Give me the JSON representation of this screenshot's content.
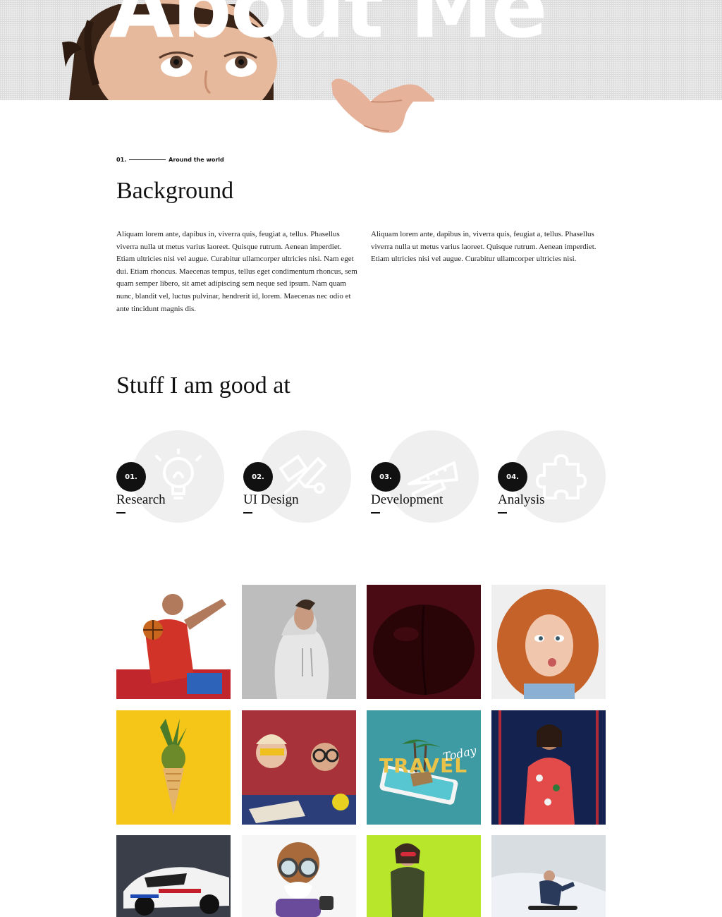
{
  "hero": {
    "title": "About Me"
  },
  "background_section": {
    "index": "01.",
    "tagline": "Around the world",
    "heading": "Background",
    "paragraph_left": "Aliquam lorem ante, dapibus in, viverra quis, feugiat a, tellus. Phasellus viverra nulla ut metus varius laoreet. Quisque rutrum. Aenean imperdiet. Etiam ultricies nisi vel augue. Curabitur ullamcorper ultricies nisi. Nam eget dui. Etiam rhoncus. Maecenas tempus, tellus eget condimentum rhoncus, sem quam semper libero, sit amet adipiscing sem neque sed ipsum. Nam quam nunc, blandit vel, luctus pulvinar, hendrerit id, lorem. Maecenas nec odio et ante tincidunt magnis dis.",
    "paragraph_right": "Aliquam lorem ante, dapibus in, viverra quis, feugiat a, tellus. Phasellus viverra nulla ut metus varius laoreet. Quisque rutrum. Aenean imperdiet. Etiam ultricies nisi vel augue. Curabitur ullamcorper ultricies nisi."
  },
  "skills_section": {
    "heading": "Stuff I am good at",
    "items": [
      {
        "number": "01.",
        "label": "Research",
        "icon": "lightbulb-icon"
      },
      {
        "number": "02.",
        "label": "UI Design",
        "icon": "design-tools-icon"
      },
      {
        "number": "03.",
        "label": "Development",
        "icon": "ruler-pencil-icon"
      },
      {
        "number": "04.",
        "label": "Analysis",
        "icon": "puzzle-icon"
      }
    ]
  },
  "gallery": {
    "tiles": [
      {
        "name": "basketball-player-photo",
        "bg": "#ffffff"
      },
      {
        "name": "woman-hoodie-photo",
        "bg": "#bdbdbd"
      },
      {
        "name": "dark-fruit-photo",
        "bg": "#4a0b14"
      },
      {
        "name": "curly-redhead-photo",
        "bg": "#efefef"
      },
      {
        "name": "pineapple-cone-photo",
        "bg": "#f5c518"
      },
      {
        "name": "kids-science-photo",
        "bg": "#a8323a"
      },
      {
        "name": "travel-phone-photo",
        "bg": "#3e9aa3",
        "overlay_text": "TRAVEL",
        "overlay_script": "Today"
      },
      {
        "name": "speaker-woman-photo",
        "bg": "#1a2a5a"
      },
      {
        "name": "race-car-photo",
        "bg": "#3a3e48"
      },
      {
        "name": "pilot-toy-photo",
        "bg": "#f6f6f6"
      },
      {
        "name": "woman-green-photo",
        "bg": "#b8e62a"
      },
      {
        "name": "snowboarder-photo",
        "bg": "#d8dde2"
      }
    ]
  }
}
